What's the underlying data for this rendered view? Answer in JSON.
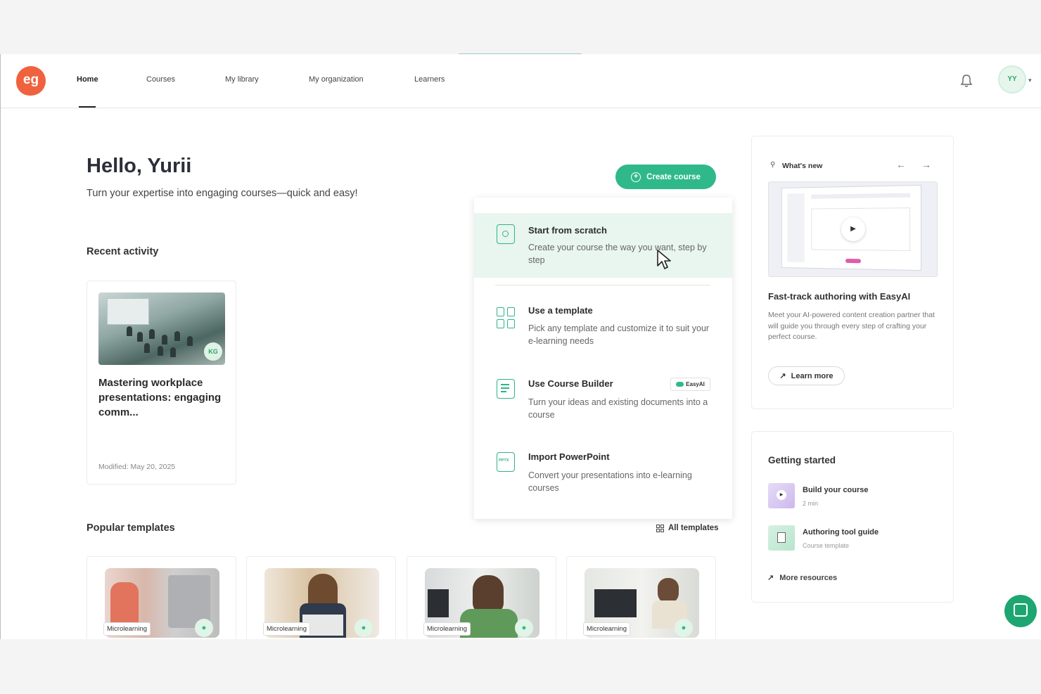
{
  "header": {
    "logo_text": "eg",
    "nav": [
      {
        "label": "Home",
        "active": true
      },
      {
        "label": "Courses"
      },
      {
        "label": "My library"
      },
      {
        "label": "My organization"
      },
      {
        "label": "Learners"
      }
    ],
    "avatar_initials": "YY",
    "icons": [
      "bell-icon",
      "chevron-down-icon"
    ]
  },
  "main": {
    "greeting": "Hello, Yurii",
    "subtitle": "Turn your expertise into engaging courses—quick and easy!",
    "create_button": "Create course",
    "recent_activity_title": "Recent activity",
    "recent_card": {
      "title": "Mastering workplace presentations: engaging comm...",
      "badge": "KG",
      "modified": "Modified: May 20, 2025"
    },
    "popular_templates_title": "Popular templates",
    "all_templates_label": "All templates",
    "templates": [
      {
        "badge": "Microlearning"
      },
      {
        "badge": "Microlearning"
      },
      {
        "badge": "Microlearning"
      },
      {
        "badge": "Microlearning"
      }
    ]
  },
  "create_menu": {
    "options": [
      {
        "title": "Start from scratch",
        "description": "Create your course the way you want, step by step",
        "highlighted": true
      },
      {
        "title": "Use a template",
        "description": "Pick any template and customize it to suit your e-learning needs"
      },
      {
        "title": "Use Course Builder",
        "description": "Turn your ideas and existing documents into a course",
        "tag": "EasyAI"
      },
      {
        "title": "Import PowerPoint",
        "description": "Convert your presentations into e-learning courses",
        "icon_text": "PPTX"
      }
    ]
  },
  "whats_new": {
    "label": "What's new",
    "title": "Fast-track authoring with EasyAI",
    "description": "Meet your AI-powered content creation partner that will guide you through every step of crafting your perfect course.",
    "learn_more": "Learn more"
  },
  "getting_started": {
    "title": "Getting started",
    "items": [
      {
        "name": "Build your course",
        "meta": "2 min"
      },
      {
        "name": "Authoring tool guide",
        "meta": "Course template"
      }
    ],
    "more_resources": "More resources"
  },
  "colors": {
    "accent": "#2fb98a",
    "logo": "#f0623e",
    "highlight": "#e8f6ef"
  }
}
